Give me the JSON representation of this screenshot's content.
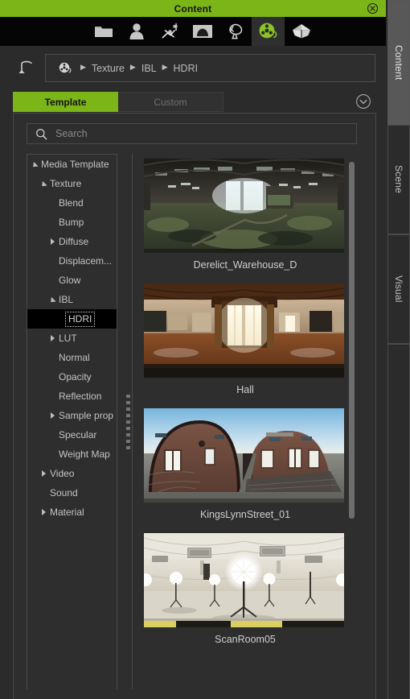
{
  "window": {
    "title": "Content",
    "close_label": "close"
  },
  "toolbar": {
    "items": [
      {
        "name": "folder-icon",
        "label": "Project",
        "selected": false
      },
      {
        "name": "character-icon",
        "label": "Character",
        "selected": false
      },
      {
        "name": "animation-icon",
        "label": "Animation",
        "selected": false
      },
      {
        "name": "stage-icon",
        "label": "Stage",
        "selected": false
      },
      {
        "name": "prop-icon",
        "label": "Prop",
        "selected": false
      },
      {
        "name": "media-icon",
        "label": "Media",
        "selected": true
      },
      {
        "name": "package-icon",
        "label": "Package",
        "selected": false
      }
    ]
  },
  "nav": {
    "back_label": "Back",
    "breadcrumb_icon": "media-icon",
    "breadcrumb": [
      "Texture",
      "IBL",
      "HDRI"
    ],
    "separator": "▶"
  },
  "tabs": {
    "items": [
      {
        "label": "Template",
        "active": true
      },
      {
        "label": "Custom",
        "active": false
      }
    ],
    "expand_icon": "chevron-down-icon"
  },
  "search": {
    "placeholder": "Search",
    "value": "",
    "icon": "search-icon"
  },
  "tree": {
    "nodes": [
      {
        "label": "Media Template",
        "depth": 0,
        "state": "open",
        "selected": false
      },
      {
        "label": "Texture",
        "depth": 1,
        "state": "open",
        "selected": false
      },
      {
        "label": "Blend",
        "depth": 2,
        "state": "leaf",
        "selected": false
      },
      {
        "label": "Bump",
        "depth": 2,
        "state": "leaf",
        "selected": false
      },
      {
        "label": "Diffuse",
        "depth": 2,
        "state": "closed",
        "selected": false
      },
      {
        "label": "Displacem...",
        "depth": 2,
        "state": "leaf",
        "selected": false
      },
      {
        "label": "Glow",
        "depth": 2,
        "state": "leaf",
        "selected": false
      },
      {
        "label": "IBL",
        "depth": 2,
        "state": "open",
        "selected": false
      },
      {
        "label": "HDRI",
        "depth": 3,
        "state": "leaf",
        "selected": true
      },
      {
        "label": "LUT",
        "depth": 2,
        "state": "closed",
        "selected": false
      },
      {
        "label": "Normal",
        "depth": 2,
        "state": "leaf",
        "selected": false
      },
      {
        "label": "Opacity",
        "depth": 2,
        "state": "leaf",
        "selected": false
      },
      {
        "label": "Reflection",
        "depth": 2,
        "state": "leaf",
        "selected": false
      },
      {
        "label": "Sample prop",
        "depth": 2,
        "state": "closed",
        "selected": false
      },
      {
        "label": "Specular",
        "depth": 2,
        "state": "leaf",
        "selected": false
      },
      {
        "label": "Weight Map",
        "depth": 2,
        "state": "leaf",
        "selected": false
      },
      {
        "label": "Video",
        "depth": 1,
        "state": "closed",
        "selected": false
      },
      {
        "label": "Sound",
        "depth": 1,
        "state": "leaf",
        "selected": false
      },
      {
        "label": "Material",
        "depth": 1,
        "state": "closed",
        "selected": false
      }
    ]
  },
  "assets": {
    "items": [
      {
        "caption": "Derelict_Warehouse_D",
        "thumb": "warehouse"
      },
      {
        "caption": "Hall",
        "thumb": "hall"
      },
      {
        "caption": "KingsLynnStreet_01",
        "thumb": "street"
      },
      {
        "caption": "ScanRoom05",
        "thumb": "scanroom"
      }
    ]
  },
  "side_tabs": {
    "items": [
      {
        "label": "Content",
        "selected": true
      },
      {
        "label": "Scene",
        "selected": false
      },
      {
        "label": "Visual",
        "selected": false
      }
    ]
  },
  "colors": {
    "accent": "#7cb518",
    "window_bg": "#2b2b2b",
    "panel_bg": "#2e2e2e",
    "toolbar_bg": "#050505",
    "border": "#4a4a4a",
    "text": "#c9c9c9"
  }
}
